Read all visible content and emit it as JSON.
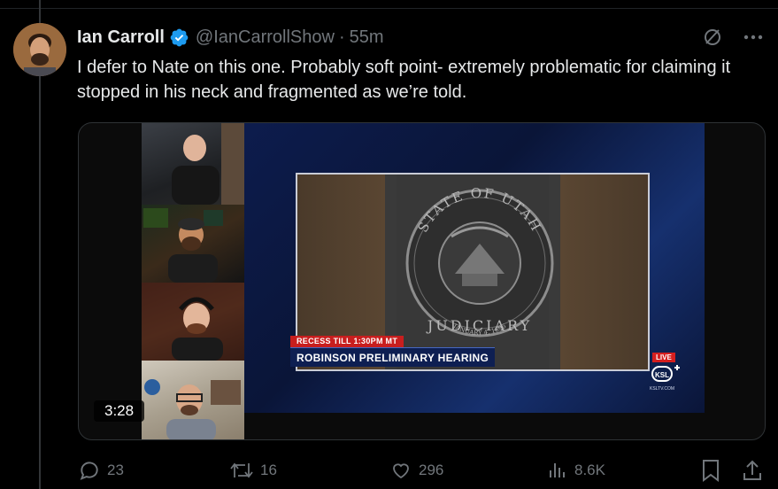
{
  "tweet": {
    "author_name": "Ian Carroll",
    "handle": "@IanCarrollShow",
    "separator": "·",
    "time": "55m",
    "text": "I defer to Nate on this one. Probably soft point- extremely problematic for claiming it stopped in his neck and fragmented as we’re told."
  },
  "video": {
    "duration": "3:28",
    "recess_banner": "RECESS TILL 1:30PM MT",
    "title_banner": "ROBINSON PRELIMINARY HEARING",
    "seal_top": "STATE OF UTAH",
    "seal_bottom": "JUDICIARY",
    "seal_date": "JANUARY 4, 1896",
    "live_label": "LIVE",
    "network_site": "KSLTV.COM"
  },
  "actions": {
    "replies": "23",
    "reposts": "16",
    "likes": "296",
    "views": "8.6K"
  },
  "colors": {
    "background": "#000000",
    "text": "#e7e9ea",
    "muted": "#71767b",
    "verified_blue": "#1d9bf0",
    "live_red": "#d51f1f"
  },
  "icons": {
    "verified": "verified-badge-icon",
    "grok": "grok-icon",
    "more": "more-icon",
    "reply": "reply-icon",
    "repost": "repost-icon",
    "like": "like-icon",
    "views": "views-icon",
    "bookmark": "bookmark-icon",
    "share": "share-icon"
  }
}
